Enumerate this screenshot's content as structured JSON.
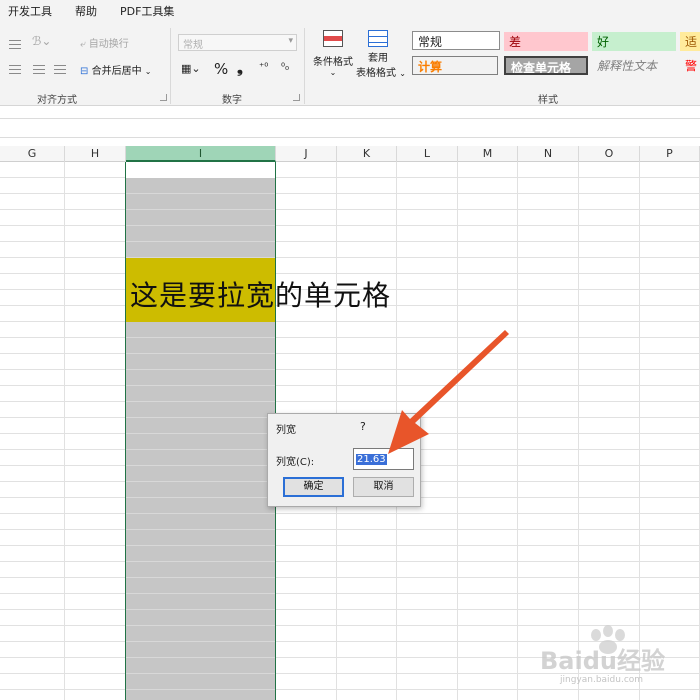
{
  "menu": {
    "items": [
      "开发工具",
      "帮助",
      "PDF工具集"
    ]
  },
  "ribbon": {
    "alignment": {
      "wrap_text": "自动换行",
      "merge_center": "合并后居中",
      "group_label": "对齐方式"
    },
    "number": {
      "format_value": "常规",
      "percent": "%",
      "comma": "❟",
      "group_label": "数字"
    },
    "styles": {
      "conditional_format": "条件格式",
      "table_format_line1": "套用",
      "table_format_line2": "表格格式",
      "normal": "常规",
      "bad": "差",
      "good": "好",
      "neutral": "适",
      "calculation": "计算",
      "check_cell": "检查单元格",
      "explanatory": "解释性文本",
      "warning": "警",
      "group_label": "样式"
    }
  },
  "sheet": {
    "columns": [
      {
        "letter": "G"
      },
      {
        "letter": "H"
      },
      {
        "letter": "I"
      },
      {
        "letter": "J"
      },
      {
        "letter": "K"
      },
      {
        "letter": "L"
      },
      {
        "letter": "M"
      },
      {
        "letter": "N"
      },
      {
        "letter": "O"
      },
      {
        "letter": "P"
      }
    ],
    "selected_column": "I",
    "cell_text": "这是要拉宽的单元格"
  },
  "dialog": {
    "title": "列宽",
    "help": "?",
    "label": "列宽(C):",
    "value": "21.63",
    "ok": "确定",
    "cancel": "取消"
  },
  "colors": {
    "accent": "#217346",
    "highlight_cell": "#cdbc00",
    "arrow": "#e8552a"
  },
  "watermark": {
    "text": "Baidu经验",
    "sub": "jingyan.baidu.com"
  }
}
